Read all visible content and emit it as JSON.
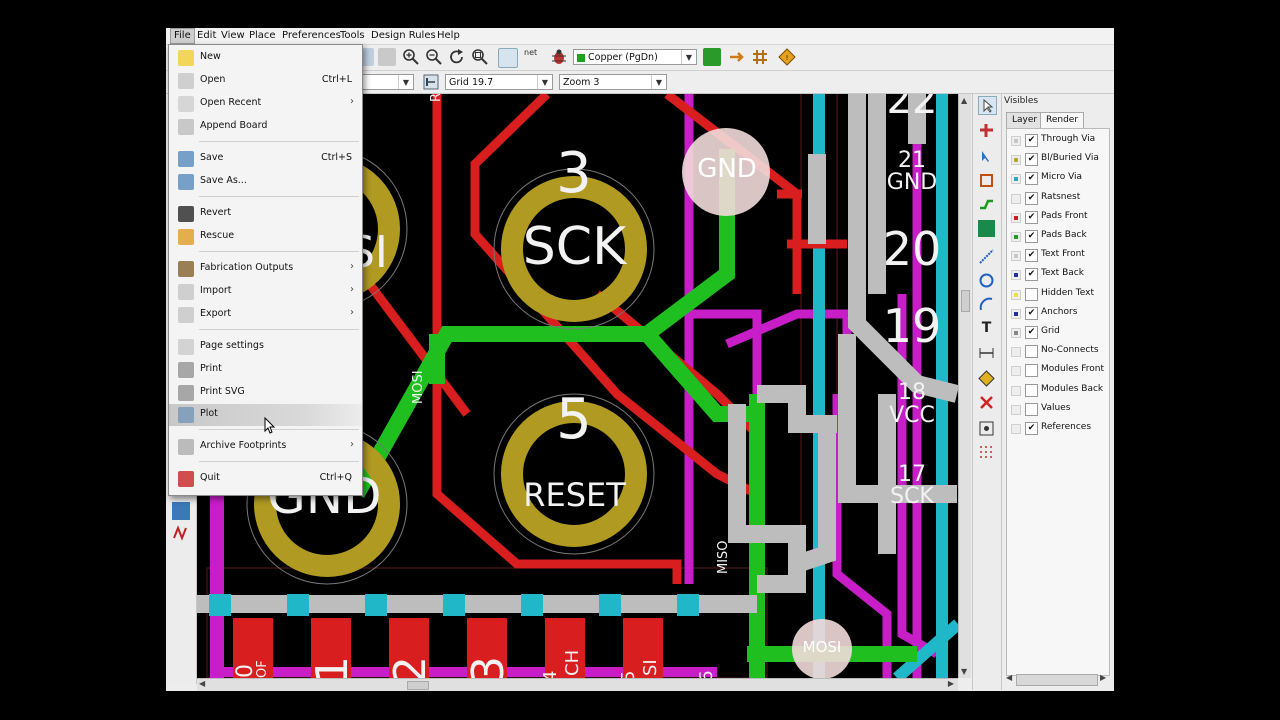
{
  "menubar": {
    "items": [
      "File",
      "Edit",
      "View",
      "Place",
      "Preferences",
      "Tools",
      "Design Rules",
      "Help"
    ]
  },
  "toolbar": {
    "layer_select": "Copper (PgDn)",
    "grid_select": "Grid 19.7",
    "zoom_select": "Zoom 3",
    "net_label": "net"
  },
  "file_menu": {
    "items": [
      {
        "label": "New",
        "shortcut": "",
        "submenu": false,
        "icon": "new-icon"
      },
      {
        "label": "Open",
        "shortcut": "Ctrl+L",
        "submenu": false,
        "icon": "open-icon"
      },
      {
        "label": "Open Recent",
        "shortcut": "",
        "submenu": true,
        "icon": "open-recent-icon"
      },
      {
        "label": "Append Board",
        "shortcut": "",
        "submenu": false,
        "icon": "append-board-icon"
      },
      {
        "label": "Save",
        "shortcut": "Ctrl+S",
        "submenu": false,
        "icon": "save-icon"
      },
      {
        "label": "Save As...",
        "shortcut": "",
        "submenu": false,
        "icon": "save-as-icon"
      },
      {
        "label": "Revert",
        "shortcut": "",
        "submenu": false,
        "icon": "revert-icon"
      },
      {
        "label": "Rescue",
        "shortcut": "",
        "submenu": false,
        "icon": "rescue-icon"
      },
      {
        "label": "Fabrication Outputs",
        "shortcut": "",
        "submenu": true,
        "icon": "fabrication-icon"
      },
      {
        "label": "Import",
        "shortcut": "",
        "submenu": true,
        "icon": "import-icon"
      },
      {
        "label": "Export",
        "shortcut": "",
        "submenu": true,
        "icon": "export-icon"
      },
      {
        "label": "Page settings",
        "shortcut": "",
        "submenu": false,
        "icon": "page-settings-icon"
      },
      {
        "label": "Print",
        "shortcut": "",
        "submenu": false,
        "icon": "print-icon"
      },
      {
        "label": "Print SVG",
        "shortcut": "",
        "submenu": false,
        "icon": "print-svg-icon"
      },
      {
        "label": "Plot",
        "shortcut": "",
        "submenu": false,
        "icon": "plot-icon",
        "highlighted": true
      },
      {
        "label": "Archive Footprints",
        "shortcut": "",
        "submenu": true,
        "icon": "archive-icon"
      },
      {
        "label": "Quit",
        "shortcut": "Ctrl+Q",
        "submenu": false,
        "icon": "quit-icon"
      }
    ]
  },
  "visibles": {
    "title": "Visibles",
    "tabs": [
      "Layer",
      "Render"
    ],
    "active_tab": "Render",
    "items": [
      {
        "label": "Through Via",
        "checked": true,
        "color": "#c8c8c8"
      },
      {
        "label": "Bl/Buried Via",
        "checked": true,
        "color": "#b8a830"
      },
      {
        "label": "Micro Via",
        "checked": true,
        "color": "#30a8c0"
      },
      {
        "label": "Ratsnest",
        "checked": true,
        "color": ""
      },
      {
        "label": "Pads Front",
        "checked": true,
        "color": "#d02020"
      },
      {
        "label": "Pads Back",
        "checked": true,
        "color": "#20a020"
      },
      {
        "label": "Text Front",
        "checked": true,
        "color": "#c8c8c8"
      },
      {
        "label": "Text Back",
        "checked": true,
        "color": "#2030a0"
      },
      {
        "label": "Hidden Text",
        "checked": false,
        "color": "#f0e040"
      },
      {
        "label": "Anchors",
        "checked": true,
        "color": "#2030a0"
      },
      {
        "label": "Grid",
        "checked": true,
        "color": "#888888"
      },
      {
        "label": "No-Connects",
        "checked": false,
        "color": ""
      },
      {
        "label": "Modules Front",
        "checked": false,
        "color": ""
      },
      {
        "label": "Modules Back",
        "checked": false,
        "color": ""
      },
      {
        "label": "Values",
        "checked": false,
        "color": ""
      },
      {
        "label": "References",
        "checked": true,
        "color": ""
      }
    ]
  },
  "board": {
    "pads": [
      {
        "number": "3",
        "name": "SCK"
      },
      {
        "number": "5",
        "name": "RESET"
      }
    ],
    "partial_pad_labels": [
      "SI",
      "GND"
    ],
    "gnd_via": "GND",
    "mosi_via": "MOSI",
    "header_pins": [
      {
        "number": "22",
        "name": ""
      },
      {
        "number": "21",
        "name": "GND"
      },
      {
        "number": "20",
        "name": ""
      },
      {
        "number": "19",
        "name": ""
      },
      {
        "number": "18",
        "name": "VCC"
      },
      {
        "number": "17",
        "name": "SCK"
      }
    ],
    "trace_labels": [
      "MOSI",
      "MISO",
      "R"
    ],
    "bottom_pins": [
      "0",
      "1",
      "2",
      "3",
      "4",
      "5",
      "6"
    ],
    "bottom_pin_names": [
      "OF",
      "CH",
      "SI"
    ]
  },
  "colors": {
    "copper_front": "#d81e1e",
    "copper_back": "#1fbf1f",
    "pad": "#b09a22",
    "silkscreen": "#f2f2f2",
    "magenta": "#c81ec8",
    "cyan": "#20b8c8",
    "gray": "#c0c0c0"
  }
}
